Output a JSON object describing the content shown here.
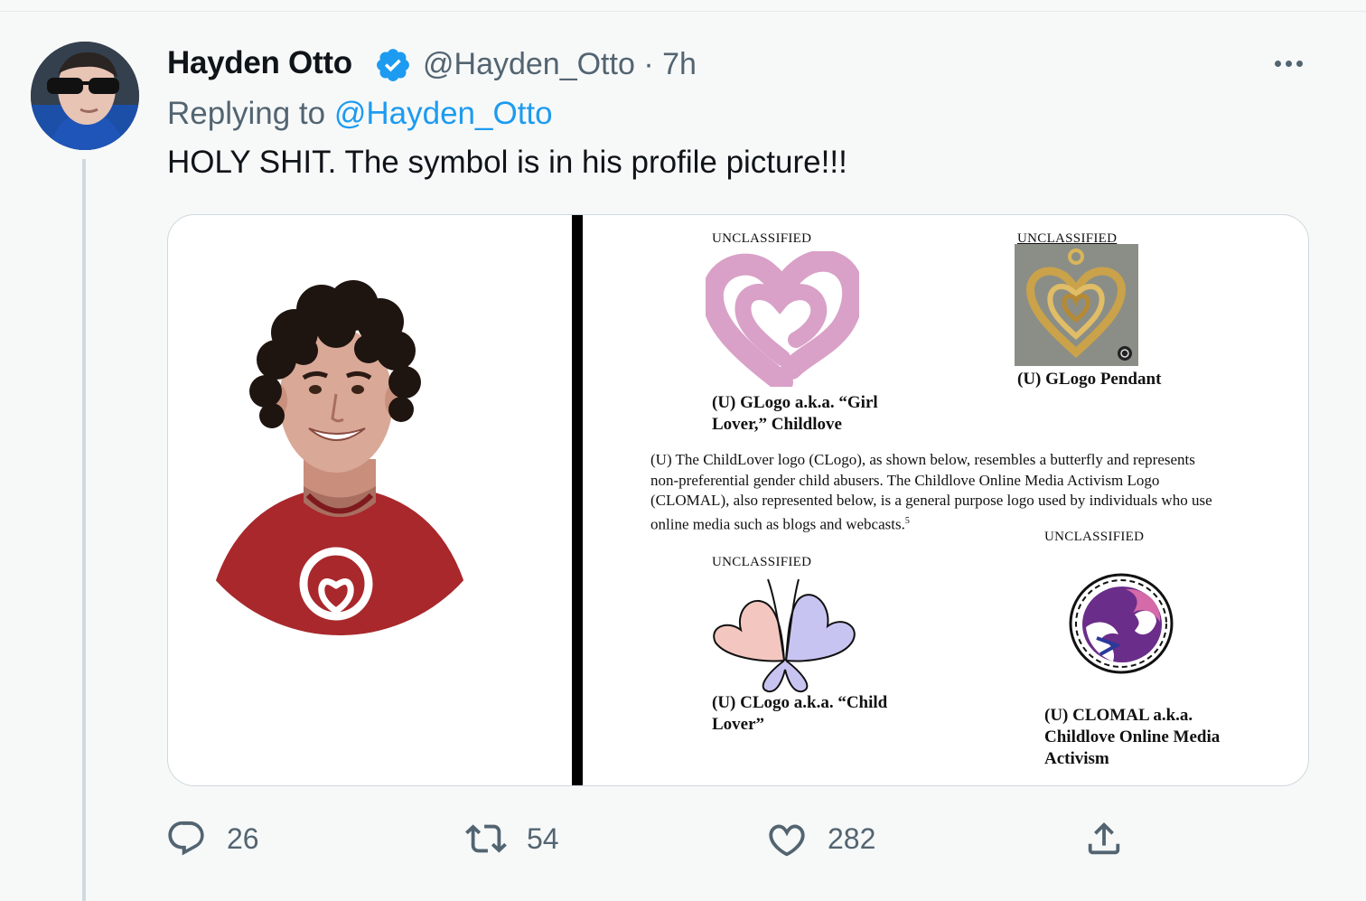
{
  "tweet": {
    "author_name": "Hayden Otto",
    "handle": "@Hayden_Otto",
    "separator": "·",
    "time": "7h",
    "replying_prefix": "Replying to",
    "replying_handle": "@Hayden_Otto",
    "text": "HOLY SHIT. The symbol is in his profile picture!!!"
  },
  "media": {
    "right_panel": {
      "glogo_header": "UNCLASSIFIED",
      "pendant_header": "UNCLASSIFIED",
      "glogo_caption_line1": "(U) GLogo a.k.a. “Girl",
      "glogo_caption_line2": "Lover,” Childlove",
      "pendant_caption": "(U) GLogo Pendant",
      "paragraph_lines": [
        "(U) The ChildLover logo (CLogo), as shown below, resembles a butterfly and represents",
        "non-preferential gender child abusers.  The Childlove Online Media Activism Logo",
        "(CLOMAL), also represented below, is a general purpose logo used by individuals who use",
        "online media such as blogs and webcasts."
      ],
      "footnote": "5",
      "cloma_header": "UNCLASSIFIED",
      "clogo_header": "UNCLASSIFIED",
      "clogo_caption_line1": "(U) CLogo a.k.a. “Child",
      "clogo_caption_line2": "Lover”",
      "cloma_caption_line1": "(U) CLOMAL a.k.a.",
      "cloma_caption_line2": "Childlove Online Media",
      "cloma_caption_line3": "Activism"
    }
  },
  "actions": {
    "replies": "26",
    "retweets": "54",
    "likes": "282"
  },
  "colors": {
    "accent": "#1d9bf0",
    "muted": "#536471",
    "background": "#f7f9f9",
    "shirt": "#a8282c",
    "heart_pink": "#d9a1c7"
  }
}
